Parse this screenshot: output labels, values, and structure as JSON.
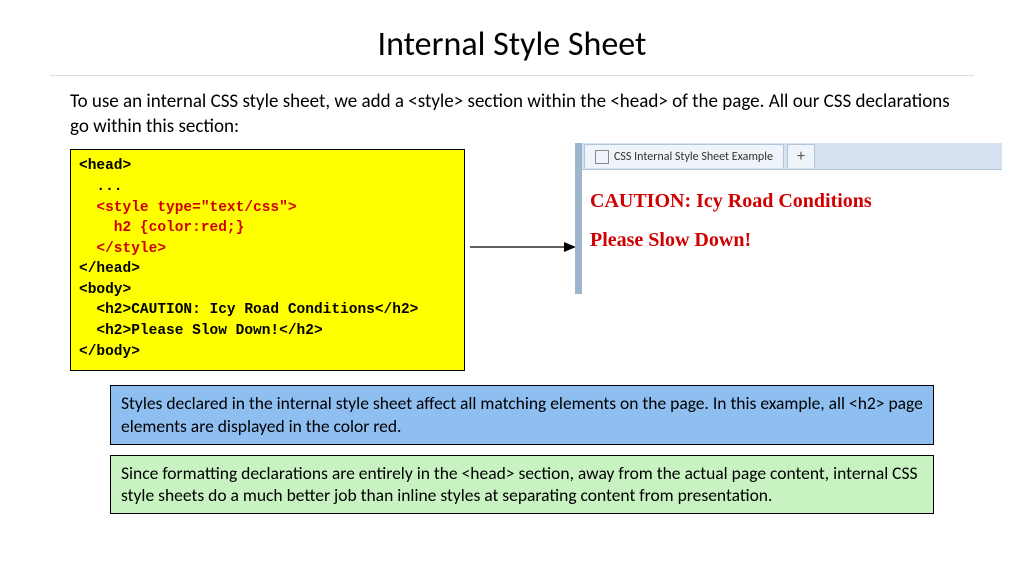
{
  "title": "Internal Style Sheet",
  "intro": "To use an internal CSS style sheet, we add a <style> section within the <head> of the page.  All our CSS declarations go within this section:",
  "code": {
    "l1": "<head>",
    "l2": "  ...",
    "l3": "  <style type=\"text/css\">",
    "l4": "    h2 {color:red;}",
    "l5": "  </style>",
    "l6": "</head>",
    "l7": "<body>",
    "l8": "  <h2>CAUTION: Icy Road Conditions</h2>",
    "l9": "  <h2>Please Slow Down!</h2>",
    "l10": "</body>"
  },
  "browser": {
    "tab_label": "CSS Internal Style Sheet Example",
    "plus": "+",
    "line1": "CAUTION: Icy Road Conditions",
    "line2": "Please Slow Down!"
  },
  "note_blue": "Styles declared in the internal style sheet affect all matching elements on the page.  In this example, all <h2> page elements are displayed in the color red.",
  "note_green": "Since formatting declarations are entirely in the <head> section, away from the actual page content, internal CSS style sheets do a much better job than inline styles at separating content from presentation."
}
